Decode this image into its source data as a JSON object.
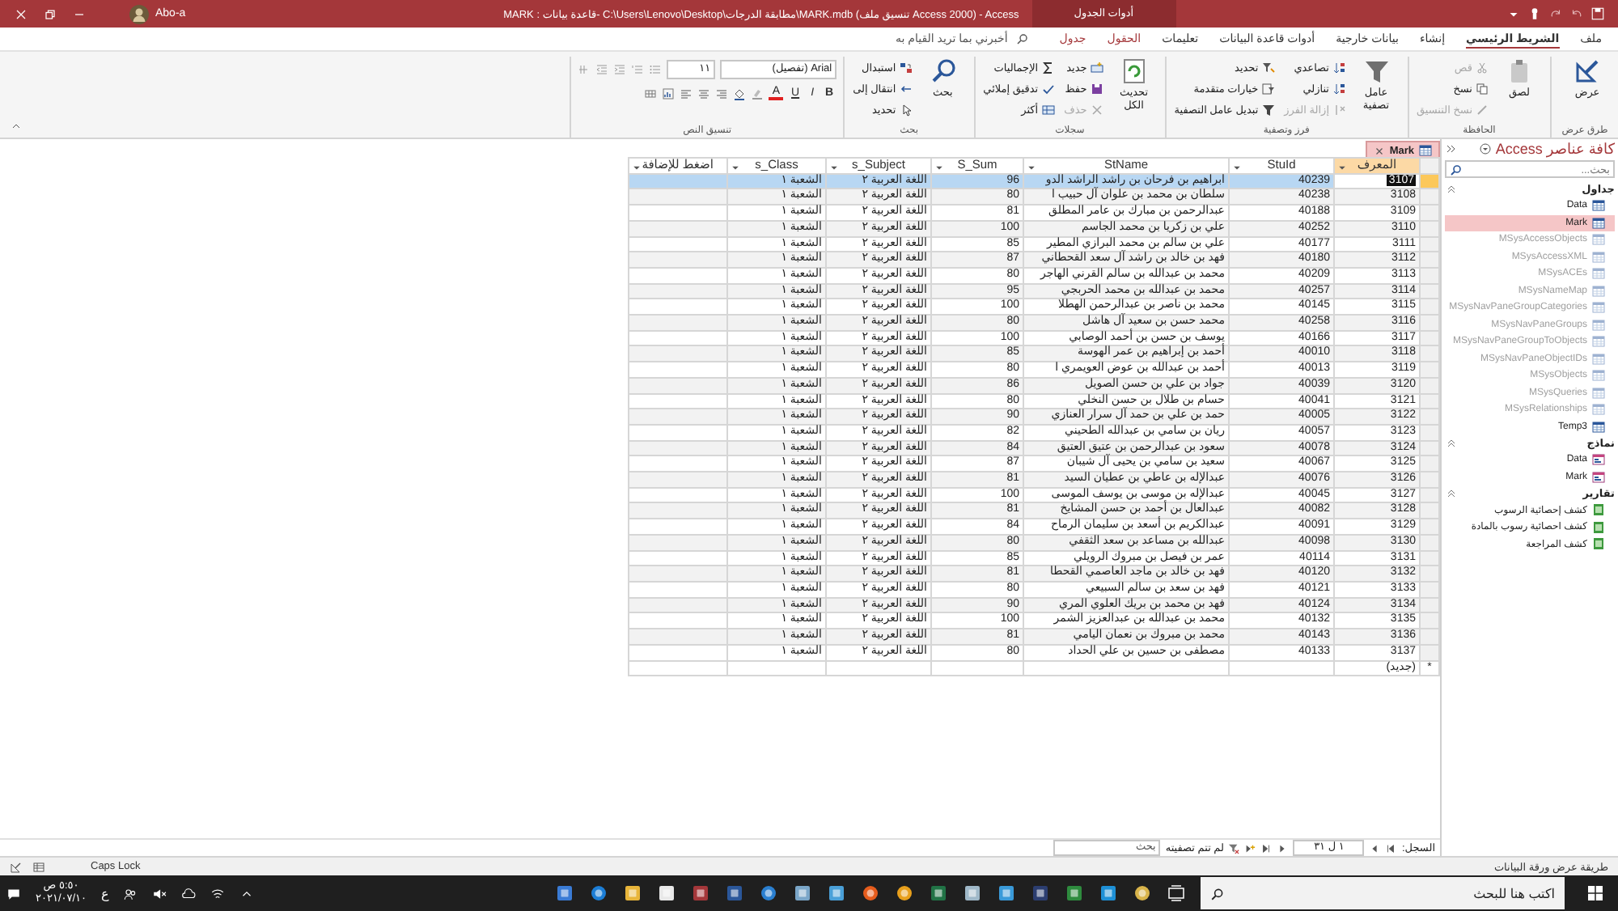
{
  "window": {
    "title": "MARK : قاعدة بيانات- C:\\Users\\Lenovo\\Desktop\\مطابقة الدرجات\\MARK.mdb (تنسيق ملف Access 2000) - Access",
    "context_tab": "أدوات الجدول",
    "user": "Abo-a"
  },
  "ribbon_tabs": [
    {
      "label": "ملف",
      "selected": false,
      "kind": "normal"
    },
    {
      "label": "الشريط الرئيسي",
      "selected": true,
      "kind": "normal"
    },
    {
      "label": "إنشاء",
      "selected": false,
      "kind": "normal"
    },
    {
      "label": "بيانات خارجية",
      "selected": false,
      "kind": "normal"
    },
    {
      "label": "أدوات قاعدة البيانات",
      "selected": false,
      "kind": "normal"
    },
    {
      "label": "تعليمات",
      "selected": false,
      "kind": "normal"
    },
    {
      "label": "الحقول",
      "selected": false,
      "kind": "context"
    },
    {
      "label": "جدول",
      "selected": false,
      "kind": "context"
    }
  ],
  "tell_me": {
    "placeholder": "أخبرني بما تريد القيام به"
  },
  "ribbon_groups": [
    {
      "title": "طرق عرض",
      "kind": "buttons",
      "items": [
        {
          "label": "عرض",
          "kind": "large",
          "disabled": false
        }
      ]
    },
    {
      "title": "الحافظة",
      "kind": "buttons",
      "items": [
        {
          "label": "لصق",
          "kind": "large",
          "disabled": false
        },
        {
          "label": "قص",
          "kind": "small",
          "disabled": true
        },
        {
          "label": "نسخ",
          "kind": "small",
          "disabled": false
        },
        {
          "label": "نسخ التنسيق",
          "kind": "small",
          "disabled": true
        }
      ]
    },
    {
      "title": "فرز وتصفية",
      "kind": "buttons",
      "items": [
        {
          "label": "عامل تصفية",
          "kind": "large",
          "disabled": false
        },
        {
          "label": "تصاعدي",
          "kind": "small",
          "disabled": false
        },
        {
          "label": "تنازلي",
          "kind": "small",
          "disabled": false
        },
        {
          "label": "إزالة الفرز",
          "kind": "small",
          "disabled": true
        },
        {
          "label": "تحديد",
          "kind": "small",
          "disabled": false
        },
        {
          "label": "خيارات متقدمة",
          "kind": "small",
          "disabled": false
        },
        {
          "label": "تبديل عامل التصفية",
          "kind": "small",
          "disabled": false
        }
      ]
    },
    {
      "title": "سجلات",
      "kind": "buttons",
      "items": [
        {
          "label": "تحديث الكل",
          "kind": "large",
          "disabled": false
        },
        {
          "label": "جديد",
          "kind": "small",
          "disabled": false
        },
        {
          "label": "حفظ",
          "kind": "small",
          "disabled": false
        },
        {
          "label": "حذف",
          "kind": "small",
          "disabled": true
        },
        {
          "label": "الإجماليات",
          "kind": "small",
          "disabled": false
        },
        {
          "label": "تدقيق إملائي",
          "kind": "small",
          "disabled": false
        },
        {
          "label": "أكثر",
          "kind": "small",
          "disabled": false
        }
      ]
    },
    {
      "title": "بحث",
      "kind": "buttons",
      "items": [
        {
          "label": "بحث",
          "kind": "large",
          "disabled": false
        },
        {
          "label": "استبدال",
          "kind": "small",
          "disabled": false
        },
        {
          "label": "انتقال إلى",
          "kind": "small",
          "disabled": false
        },
        {
          "label": "تحديد",
          "kind": "small",
          "disabled": false
        }
      ]
    },
    {
      "title": "تنسيق النص",
      "kind": "text",
      "font": "Arial (تفصيل)",
      "size": "١١",
      "buttons": [
        {
          "label": "B",
          "kind": "bold"
        },
        {
          "label": "I",
          "kind": "italic"
        },
        {
          "label": "U",
          "kind": "underline"
        },
        {
          "label": "A",
          "kind": "font-color"
        }
      ]
    }
  ],
  "nav_pane": {
    "title": "كافة عناصر Access",
    "search": {
      "placeholder": "بحث..."
    },
    "groups": [
      {
        "title": "جداول",
        "kind": "table",
        "items": [
          {
            "label": "Data",
            "selected": false,
            "dimmed": false
          },
          {
            "label": "Mark",
            "selected": true,
            "dimmed": false
          },
          {
            "label": "MSysAccessObjects",
            "selected": false,
            "dimmed": true
          },
          {
            "label": "MSysAccessXML",
            "selected": false,
            "dimmed": true
          },
          {
            "label": "MSysACEs",
            "selected": false,
            "dimmed": true
          },
          {
            "label": "MSysNameMap",
            "selected": false,
            "dimmed": true
          },
          {
            "label": "MSysNavPaneGroupCategories",
            "selected": false,
            "dimmed": true
          },
          {
            "label": "MSysNavPaneGroups",
            "selected": false,
            "dimmed": true
          },
          {
            "label": "MSysNavPaneGroupToObjects",
            "selected": false,
            "dimmed": true
          },
          {
            "label": "MSysNavPaneObjectIDs",
            "selected": false,
            "dimmed": true
          },
          {
            "label": "MSysObjects",
            "selected": false,
            "dimmed": true
          },
          {
            "label": "MSysQueries",
            "selected": false,
            "dimmed": true
          },
          {
            "label": "MSysRelationships",
            "selected": false,
            "dimmed": true
          },
          {
            "label": "Temp3",
            "selected": false,
            "dimmed": false
          }
        ]
      },
      {
        "title": "نماذج",
        "kind": "form",
        "items": [
          {
            "label": "Data",
            "selected": false,
            "dimmed": false
          },
          {
            "label": "Mark",
            "selected": false,
            "dimmed": false
          }
        ]
      },
      {
        "title": "تقارير",
        "kind": "report",
        "items": [
          {
            "label": "كشف إحصائية الرسوب",
            "selected": false,
            "dimmed": false
          },
          {
            "label": "كشف احصائية رسوب بالمادة",
            "selected": false,
            "dimmed": false
          },
          {
            "label": "كشف المراجعة",
            "selected": false,
            "dimmed": false
          }
        ]
      }
    ]
  },
  "document_tab": {
    "label": "Mark"
  },
  "table": {
    "columns": [
      {
        "label": "المعرف",
        "selected": true
      },
      {
        "label": "StuId",
        "selected": false
      },
      {
        "label": "StName",
        "selected": false
      },
      {
        "label": "S_Sum",
        "selected": false
      },
      {
        "label": "s_Subject",
        "selected": false
      },
      {
        "label": "s_Class",
        "selected": false
      },
      {
        "label": "اضغط للإضافة",
        "selected": false
      }
    ],
    "rows": [
      {
        "id": "3107",
        "stu_id": "40239",
        "name": "ابراهيم بن فرحان بن راشد الراشد الدو",
        "sum": "96",
        "subject": "اللغة العربية ٢",
        "class": "الشعبة ١",
        "selected": true
      },
      {
        "id": "3108",
        "stu_id": "40238",
        "name": "سلطان بن محمد بن علوان آل حبيب ا",
        "sum": "80",
        "subject": "اللغة العربية ٢",
        "class": "الشعبة ١",
        "selected": false
      },
      {
        "id": "3109",
        "stu_id": "40188",
        "name": "عبدالرحمن بن مبارك بن عامر المطلق",
        "sum": "81",
        "subject": "اللغة العربية ٢",
        "class": "الشعبة ١",
        "selected": false
      },
      {
        "id": "3110",
        "stu_id": "40252",
        "name": "علي بن زكريا بن محمد الجاسم",
        "sum": "100",
        "subject": "اللغة العربية ٢",
        "class": "الشعبة ١",
        "selected": false
      },
      {
        "id": "3111",
        "stu_id": "40177",
        "name": "علي بن سالم بن محمد البرازي المطير",
        "sum": "85",
        "subject": "اللغة العربية ٢",
        "class": "الشعبة ١",
        "selected": false
      },
      {
        "id": "3112",
        "stu_id": "40180",
        "name": "فهد بن خالد بن راشد آل سعد القحطاني",
        "sum": "87",
        "subject": "اللغة العربية ٢",
        "class": "الشعبة ١",
        "selected": false
      },
      {
        "id": "3113",
        "stu_id": "40209",
        "name": "محمد بن عبدالله بن سالم القرني الهاجر",
        "sum": "80",
        "subject": "اللغة العربية ٢",
        "class": "الشعبة ١",
        "selected": false
      },
      {
        "id": "3114",
        "stu_id": "40257",
        "name": "محمد بن عبدالله بن محمد الحربجي",
        "sum": "95",
        "subject": "اللغة العربية ٢",
        "class": "الشعبة ١",
        "selected": false
      },
      {
        "id": "3115",
        "stu_id": "40145",
        "name": "محمد بن ناصر بن عبدالرحمن الهطلا",
        "sum": "100",
        "subject": "اللغة العربية ٢",
        "class": "الشعبة ١",
        "selected": false
      },
      {
        "id": "3116",
        "stu_id": "40258",
        "name": "محمد حسن بن سعيد آل هاشل",
        "sum": "80",
        "subject": "اللغة العربية ٢",
        "class": "الشعبة ١",
        "selected": false
      },
      {
        "id": "3117",
        "stu_id": "40166",
        "name": "يوسف بن حسن بن أحمد الوصابي",
        "sum": "100",
        "subject": "اللغة العربية ٢",
        "class": "الشعبة ١",
        "selected": false
      },
      {
        "id": "3118",
        "stu_id": "40010",
        "name": "أحمد بن إبراهيم بن عمر الهوسة",
        "sum": "85",
        "subject": "اللغة العربية ٢",
        "class": "الشعبة ١",
        "selected": false
      },
      {
        "id": "3119",
        "stu_id": "40013",
        "name": "أحمد بن عبدالله بن عوض العويمري ا",
        "sum": "80",
        "subject": "اللغة العربية ٢",
        "class": "الشعبة ١",
        "selected": false
      },
      {
        "id": "3120",
        "stu_id": "40039",
        "name": "جواد بن علي بن حسن الصويل",
        "sum": "86",
        "subject": "اللغة العربية ٢",
        "class": "الشعبة ١",
        "selected": false
      },
      {
        "id": "3121",
        "stu_id": "40041",
        "name": "حسام بن طلال بن حسن النخلي",
        "sum": "80",
        "subject": "اللغة العربية ٢",
        "class": "الشعبة ١",
        "selected": false
      },
      {
        "id": "3122",
        "stu_id": "40005",
        "name": "حمد بن علي بن حمد آل سرار العنازي",
        "sum": "90",
        "subject": "اللغة العربية ٢",
        "class": "الشعبة ١",
        "selected": false
      },
      {
        "id": "3123",
        "stu_id": "40057",
        "name": "ريان بن سامي بن عبدالله الطحيني",
        "sum": "82",
        "subject": "اللغة العربية ٢",
        "class": "الشعبة ١",
        "selected": false
      },
      {
        "id": "3124",
        "stu_id": "40078",
        "name": "سعود بن عبدالرحمن بن عتيق العتيق",
        "sum": "84",
        "subject": "اللغة العربية ٢",
        "class": "الشعبة ١",
        "selected": false
      },
      {
        "id": "3125",
        "stu_id": "40067",
        "name": "سعيد بن سامي بن يحيى آل شيبان",
        "sum": "87",
        "subject": "اللغة العربية ٢",
        "class": "الشعبة ١",
        "selected": false
      },
      {
        "id": "3126",
        "stu_id": "40076",
        "name": "عبدالإله بن عاطي بن عطيان السيد",
        "sum": "81",
        "subject": "اللغة العربية ٢",
        "class": "الشعبة ١",
        "selected": false
      },
      {
        "id": "3127",
        "stu_id": "40045",
        "name": "عبدالإله بن موسى بن يوسف الموسى",
        "sum": "100",
        "subject": "اللغة العربية ٢",
        "class": "الشعبة ١",
        "selected": false
      },
      {
        "id": "3128",
        "stu_id": "40082",
        "name": "عبدالعال بن أحمد بن حسن المشايخ",
        "sum": "81",
        "subject": "اللغة العربية ٢",
        "class": "الشعبة ١",
        "selected": false
      },
      {
        "id": "3129",
        "stu_id": "40091",
        "name": "عبدالكريم بن أسعد بن سليمان الرماح",
        "sum": "84",
        "subject": "اللغة العربية ٢",
        "class": "الشعبة ١",
        "selected": false
      },
      {
        "id": "3130",
        "stu_id": "40098",
        "name": "عبدالله بن مساعد بن سعد الثقفي",
        "sum": "80",
        "subject": "اللغة العربية ٢",
        "class": "الشعبة ١",
        "selected": false
      },
      {
        "id": "3131",
        "stu_id": "40114",
        "name": "عمر بن فيصل بن مبروك الرويلي",
        "sum": "85",
        "subject": "اللغة العربية ٢",
        "class": "الشعبة ١",
        "selected": false
      },
      {
        "id": "3132",
        "stu_id": "40120",
        "name": "فهد بن خالد بن ماجد العاصمي القحطا",
        "sum": "81",
        "subject": "اللغة العربية ٢",
        "class": "الشعبة ١",
        "selected": false
      },
      {
        "id": "3133",
        "stu_id": "40121",
        "name": "فهد بن سعد بن سالم السبيعي",
        "sum": "80",
        "subject": "اللغة العربية ٢",
        "class": "الشعبة ١",
        "selected": false
      },
      {
        "id": "3134",
        "stu_id": "40124",
        "name": "فهد بن محمد بن بريك العلوي المري",
        "sum": "90",
        "subject": "اللغة العربية ٢",
        "class": "الشعبة ١",
        "selected": false
      },
      {
        "id": "3135",
        "stu_id": "40132",
        "name": "محمد بن عبدالله بن عبدالعزيز الشمر",
        "sum": "100",
        "subject": "اللغة العربية ٢",
        "class": "الشعبة ١",
        "selected": false
      },
      {
        "id": "3136",
        "stu_id": "40143",
        "name": "محمد بن مبروك بن نعمان اليامي",
        "sum": "81",
        "subject": "اللغة العربية ٢",
        "class": "الشعبة ١",
        "selected": false
      },
      {
        "id": "3137",
        "stu_id": "40133",
        "name": "مصطفى بن حسين بن علي الحداد",
        "sum": "80",
        "subject": "اللغة العربية ٢",
        "class": "الشعبة ١",
        "selected": false
      }
    ],
    "new_row": {
      "marker": "*",
      "label": "(جديد)"
    }
  },
  "record_nav": {
    "label": "السجل:",
    "position": "١ ل ٣١",
    "filter": "لم تتم تصفيته",
    "search": {
      "placeholder": "بحث"
    }
  },
  "status_bar": {
    "view": "طريقة عرض ورقة البيانات",
    "caps": "Caps Lock"
  },
  "taskbar": {
    "search": {
      "placeholder": "اكتب هنا للبحث"
    },
    "language": "ع",
    "time": "٥:٥٠ ص",
    "date": "٢٠٢١/٠٧/١٠"
  }
}
